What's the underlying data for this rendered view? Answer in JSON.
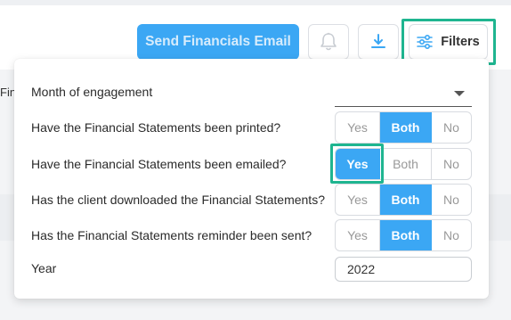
{
  "toolbar": {
    "send_label": "Send Financials Email",
    "filters_label": "Filters",
    "bell_icon": "bell-icon",
    "download_icon": "download-icon",
    "filters_icon": "sliders-icon"
  },
  "background": {
    "clipped_text": "Financial"
  },
  "filters": {
    "month": {
      "label": "Month of engagement",
      "value": ""
    },
    "printed": {
      "label": "Have the Financial Statements been printed?",
      "options": [
        "Yes",
        "Both",
        "No"
      ],
      "selected": "Both"
    },
    "emailed": {
      "label": "Have the Financial Statements been emailed?",
      "options": [
        "Yes",
        "Both",
        "No"
      ],
      "selected": "Yes"
    },
    "downloaded": {
      "label": "Has the client downloaded the Financial Statements?",
      "options": [
        "Yes",
        "Both",
        "No"
      ],
      "selected": "Both"
    },
    "reminder": {
      "label": "Has the Financial Statements reminder been sent?",
      "options": [
        "Yes",
        "Both",
        "No"
      ],
      "selected": "Both"
    },
    "year": {
      "label": "Year",
      "value": "2022"
    }
  },
  "colors": {
    "accent": "#3ba7f4",
    "highlight": "#1fb590"
  }
}
